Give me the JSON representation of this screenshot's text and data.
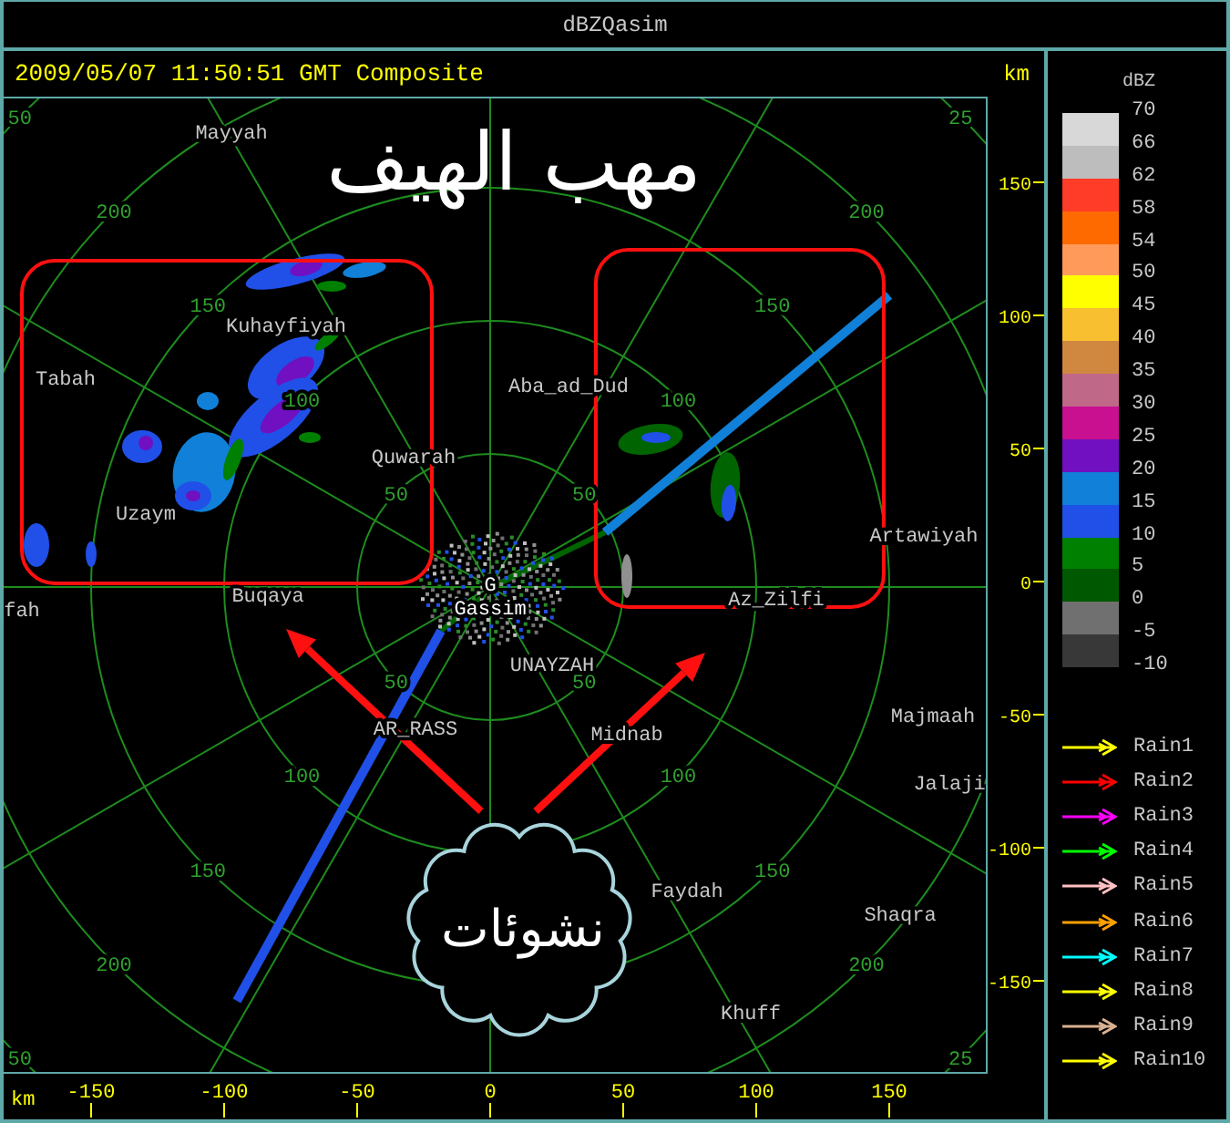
{
  "window": {
    "title": "dBZQasim"
  },
  "plot": {
    "timestamp": "2009/05/07 11:50:51 GMT Composite",
    "unit_right": "km",
    "unit_bottom": "km",
    "annotation_title": "مهب الهيف",
    "cloud_text": "نشوئات",
    "site": {
      "marker": "G",
      "name": "Gassim"
    },
    "places": [
      "Mayyah",
      "Kuhayfiyah",
      "Tabah",
      "Aba_ad_Dud",
      "Quwarah",
      "Uzaym",
      "Artawiyah",
      "Buqaya",
      "fah",
      "Az_Zilfi",
      "UNAYZAH",
      "AR_RASS",
      "Midnab",
      "Majmaah",
      "Jalaji",
      "Faydah",
      "Shaqra",
      "Khuff"
    ],
    "ring_labels": {
      "nw": [
        "50",
        "100",
        "150",
        "200",
        "50"
      ],
      "ne": [
        "50",
        "100",
        "150",
        "200",
        "25"
      ],
      "sw": [
        "50",
        "100",
        "150",
        "200",
        "50"
      ],
      "se": [
        "50",
        "100",
        "150",
        "200",
        "25"
      ]
    },
    "y_ticks": [
      "150",
      "100",
      "50",
      "0",
      "-50",
      "-100",
      "-150"
    ],
    "x_ticks": [
      "-150",
      "-100",
      "-50",
      "0",
      "50",
      "100",
      "150"
    ]
  },
  "legend": {
    "unit": "dBZ",
    "bins": [
      {
        "color": "#d8d8d8"
      },
      {
        "color": "#bdbdbd"
      },
      {
        "color": "#ff3c28"
      },
      {
        "color": "#ff6a00"
      },
      {
        "color": "#ff9a5a"
      },
      {
        "color": "#ffff00"
      },
      {
        "color": "#f8c030"
      },
      {
        "color": "#d08840"
      },
      {
        "color": "#c06888"
      },
      {
        "color": "#c81090"
      },
      {
        "color": "#7010c0"
      },
      {
        "color": "#1080d8"
      },
      {
        "color": "#2050e8"
      },
      {
        "color": "#008000"
      },
      {
        "color": "#005800"
      },
      {
        "color": "#707070"
      },
      {
        "color": "#383838"
      }
    ],
    "levels": [
      "70",
      "66",
      "62",
      "58",
      "54",
      "50",
      "45",
      "40",
      "35",
      "30",
      "25",
      "20",
      "15",
      "10",
      "5",
      "0",
      "-5",
      "-10"
    ],
    "tracks": [
      {
        "label": "Rain1",
        "color": "#ffff00"
      },
      {
        "label": "Rain2",
        "color": "#ff0000"
      },
      {
        "label": "Rain3",
        "color": "#ff00ff"
      },
      {
        "label": "Rain4",
        "color": "#00ff00"
      },
      {
        "label": "Rain5",
        "color": "#ffc0c0"
      },
      {
        "label": "Rain6",
        "color": "#ffa000"
      },
      {
        "label": "Rain7",
        "color": "#00ffff"
      },
      {
        "label": "Rain8",
        "color": "#ffff00"
      },
      {
        "label": "Rain9",
        "color": "#d8b090"
      },
      {
        "label": "Rain10",
        "color": "#ffff00"
      }
    ]
  }
}
